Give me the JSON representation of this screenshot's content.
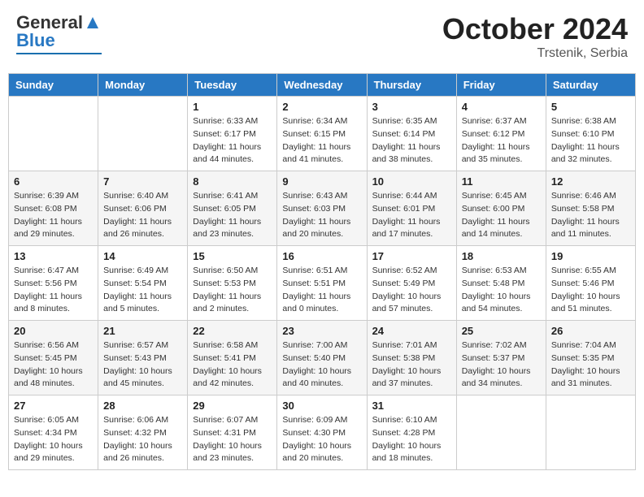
{
  "header": {
    "logo": {
      "text1": "General",
      "text2": "Blue"
    },
    "title": "October 2024",
    "location": "Trstenik, Serbia"
  },
  "weekdays": [
    "Sunday",
    "Monday",
    "Tuesday",
    "Wednesday",
    "Thursday",
    "Friday",
    "Saturday"
  ],
  "weeks": [
    [
      {
        "day": "",
        "sunrise": "",
        "sunset": "",
        "daylight": ""
      },
      {
        "day": "",
        "sunrise": "",
        "sunset": "",
        "daylight": ""
      },
      {
        "day": "1",
        "sunrise": "Sunrise: 6:33 AM",
        "sunset": "Sunset: 6:17 PM",
        "daylight": "Daylight: 11 hours and 44 minutes."
      },
      {
        "day": "2",
        "sunrise": "Sunrise: 6:34 AM",
        "sunset": "Sunset: 6:15 PM",
        "daylight": "Daylight: 11 hours and 41 minutes."
      },
      {
        "day": "3",
        "sunrise": "Sunrise: 6:35 AM",
        "sunset": "Sunset: 6:14 PM",
        "daylight": "Daylight: 11 hours and 38 minutes."
      },
      {
        "day": "4",
        "sunrise": "Sunrise: 6:37 AM",
        "sunset": "Sunset: 6:12 PM",
        "daylight": "Daylight: 11 hours and 35 minutes."
      },
      {
        "day": "5",
        "sunrise": "Sunrise: 6:38 AM",
        "sunset": "Sunset: 6:10 PM",
        "daylight": "Daylight: 11 hours and 32 minutes."
      }
    ],
    [
      {
        "day": "6",
        "sunrise": "Sunrise: 6:39 AM",
        "sunset": "Sunset: 6:08 PM",
        "daylight": "Daylight: 11 hours and 29 minutes."
      },
      {
        "day": "7",
        "sunrise": "Sunrise: 6:40 AM",
        "sunset": "Sunset: 6:06 PM",
        "daylight": "Daylight: 11 hours and 26 minutes."
      },
      {
        "day": "8",
        "sunrise": "Sunrise: 6:41 AM",
        "sunset": "Sunset: 6:05 PM",
        "daylight": "Daylight: 11 hours and 23 minutes."
      },
      {
        "day": "9",
        "sunrise": "Sunrise: 6:43 AM",
        "sunset": "Sunset: 6:03 PM",
        "daylight": "Daylight: 11 hours and 20 minutes."
      },
      {
        "day": "10",
        "sunrise": "Sunrise: 6:44 AM",
        "sunset": "Sunset: 6:01 PM",
        "daylight": "Daylight: 11 hours and 17 minutes."
      },
      {
        "day": "11",
        "sunrise": "Sunrise: 6:45 AM",
        "sunset": "Sunset: 6:00 PM",
        "daylight": "Daylight: 11 hours and 14 minutes."
      },
      {
        "day": "12",
        "sunrise": "Sunrise: 6:46 AM",
        "sunset": "Sunset: 5:58 PM",
        "daylight": "Daylight: 11 hours and 11 minutes."
      }
    ],
    [
      {
        "day": "13",
        "sunrise": "Sunrise: 6:47 AM",
        "sunset": "Sunset: 5:56 PM",
        "daylight": "Daylight: 11 hours and 8 minutes."
      },
      {
        "day": "14",
        "sunrise": "Sunrise: 6:49 AM",
        "sunset": "Sunset: 5:54 PM",
        "daylight": "Daylight: 11 hours and 5 minutes."
      },
      {
        "day": "15",
        "sunrise": "Sunrise: 6:50 AM",
        "sunset": "Sunset: 5:53 PM",
        "daylight": "Daylight: 11 hours and 2 minutes."
      },
      {
        "day": "16",
        "sunrise": "Sunrise: 6:51 AM",
        "sunset": "Sunset: 5:51 PM",
        "daylight": "Daylight: 11 hours and 0 minutes."
      },
      {
        "day": "17",
        "sunrise": "Sunrise: 6:52 AM",
        "sunset": "Sunset: 5:49 PM",
        "daylight": "Daylight: 10 hours and 57 minutes."
      },
      {
        "day": "18",
        "sunrise": "Sunrise: 6:53 AM",
        "sunset": "Sunset: 5:48 PM",
        "daylight": "Daylight: 10 hours and 54 minutes."
      },
      {
        "day": "19",
        "sunrise": "Sunrise: 6:55 AM",
        "sunset": "Sunset: 5:46 PM",
        "daylight": "Daylight: 10 hours and 51 minutes."
      }
    ],
    [
      {
        "day": "20",
        "sunrise": "Sunrise: 6:56 AM",
        "sunset": "Sunset: 5:45 PM",
        "daylight": "Daylight: 10 hours and 48 minutes."
      },
      {
        "day": "21",
        "sunrise": "Sunrise: 6:57 AM",
        "sunset": "Sunset: 5:43 PM",
        "daylight": "Daylight: 10 hours and 45 minutes."
      },
      {
        "day": "22",
        "sunrise": "Sunrise: 6:58 AM",
        "sunset": "Sunset: 5:41 PM",
        "daylight": "Daylight: 10 hours and 42 minutes."
      },
      {
        "day": "23",
        "sunrise": "Sunrise: 7:00 AM",
        "sunset": "Sunset: 5:40 PM",
        "daylight": "Daylight: 10 hours and 40 minutes."
      },
      {
        "day": "24",
        "sunrise": "Sunrise: 7:01 AM",
        "sunset": "Sunset: 5:38 PM",
        "daylight": "Daylight: 10 hours and 37 minutes."
      },
      {
        "day": "25",
        "sunrise": "Sunrise: 7:02 AM",
        "sunset": "Sunset: 5:37 PM",
        "daylight": "Daylight: 10 hours and 34 minutes."
      },
      {
        "day": "26",
        "sunrise": "Sunrise: 7:04 AM",
        "sunset": "Sunset: 5:35 PM",
        "daylight": "Daylight: 10 hours and 31 minutes."
      }
    ],
    [
      {
        "day": "27",
        "sunrise": "Sunrise: 6:05 AM",
        "sunset": "Sunset: 4:34 PM",
        "daylight": "Daylight: 10 hours and 29 minutes."
      },
      {
        "day": "28",
        "sunrise": "Sunrise: 6:06 AM",
        "sunset": "Sunset: 4:32 PM",
        "daylight": "Daylight: 10 hours and 26 minutes."
      },
      {
        "day": "29",
        "sunrise": "Sunrise: 6:07 AM",
        "sunset": "Sunset: 4:31 PM",
        "daylight": "Daylight: 10 hours and 23 minutes."
      },
      {
        "day": "30",
        "sunrise": "Sunrise: 6:09 AM",
        "sunset": "Sunset: 4:30 PM",
        "daylight": "Daylight: 10 hours and 20 minutes."
      },
      {
        "day": "31",
        "sunrise": "Sunrise: 6:10 AM",
        "sunset": "Sunset: 4:28 PM",
        "daylight": "Daylight: 10 hours and 18 minutes."
      },
      {
        "day": "",
        "sunrise": "",
        "sunset": "",
        "daylight": ""
      },
      {
        "day": "",
        "sunrise": "",
        "sunset": "",
        "daylight": ""
      }
    ]
  ]
}
